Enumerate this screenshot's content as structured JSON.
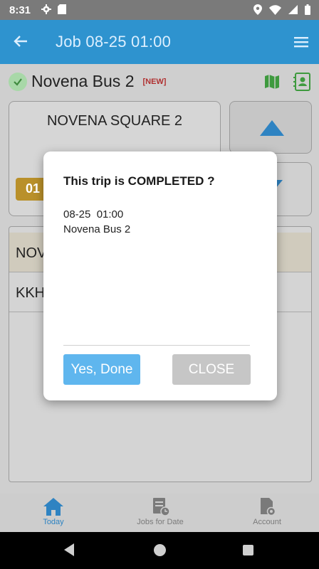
{
  "statusbar": {
    "time": "8:31"
  },
  "appbar": {
    "title": "Job 08-25  01:00"
  },
  "bus": {
    "name": "Novena Bus 2",
    "badge": "[NEW]"
  },
  "current_stop": {
    "name": "NOVENA SQUARE 2",
    "time_chip": "01"
  },
  "stops": [
    {
      "label": "NOV"
    },
    {
      "label": "KKH"
    }
  ],
  "dialog": {
    "title": "This trip is COMPLETED ?",
    "line1": "08-25  01:00",
    "line2": "Novena Bus 2",
    "yes_label": "Yes, Done",
    "close_label": "CLOSE"
  },
  "bottom_nav": {
    "today": "Today",
    "jobs_for_date": "Jobs for Date",
    "account": "Account"
  },
  "colors": {
    "appbar": "#2e93cf",
    "accent": "#2e83c2",
    "yes_button": "#5fb6ee",
    "close_button": "#c6c6c6",
    "badge": "#b03030",
    "time_chip": "#b9902a"
  },
  "icons": {
    "statusbar_left": [
      "gear-icon",
      "sd-card-icon"
    ],
    "statusbar_right": [
      "location-icon",
      "wifi-icon",
      "signal-icon",
      "battery-icon"
    ],
    "appbar": [
      "back-arrow-icon",
      "hamburger-menu-icon"
    ],
    "bus_row": [
      "check-circle-icon",
      "map-icon",
      "contact-card-icon"
    ],
    "nav": [
      "home-icon",
      "calendar-doc-icon",
      "account-doc-icon"
    ]
  }
}
